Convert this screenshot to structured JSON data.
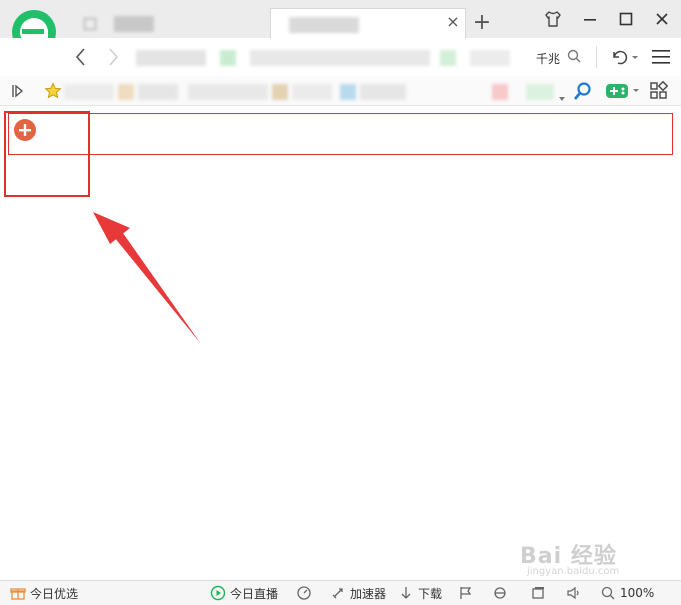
{
  "titlebar": {
    "new_tab_label": "+",
    "active_tab_close": "×"
  },
  "address_bar": {
    "partial_text": "千兆"
  },
  "content": {
    "add_button_label": "+"
  },
  "statusbar": {
    "items": [
      {
        "label": "今日优选"
      },
      {
        "label": "今日直播"
      },
      {
        "label": "加速器"
      },
      {
        "label": "下载"
      },
      {
        "label": "100%"
      }
    ]
  },
  "watermark": {
    "main": "Bai 经验",
    "sub": "jingyan.baidu.com"
  },
  "colors": {
    "accent_red": "#e0302f",
    "add_button": "#e36442",
    "logo_green": "#20c06a"
  }
}
